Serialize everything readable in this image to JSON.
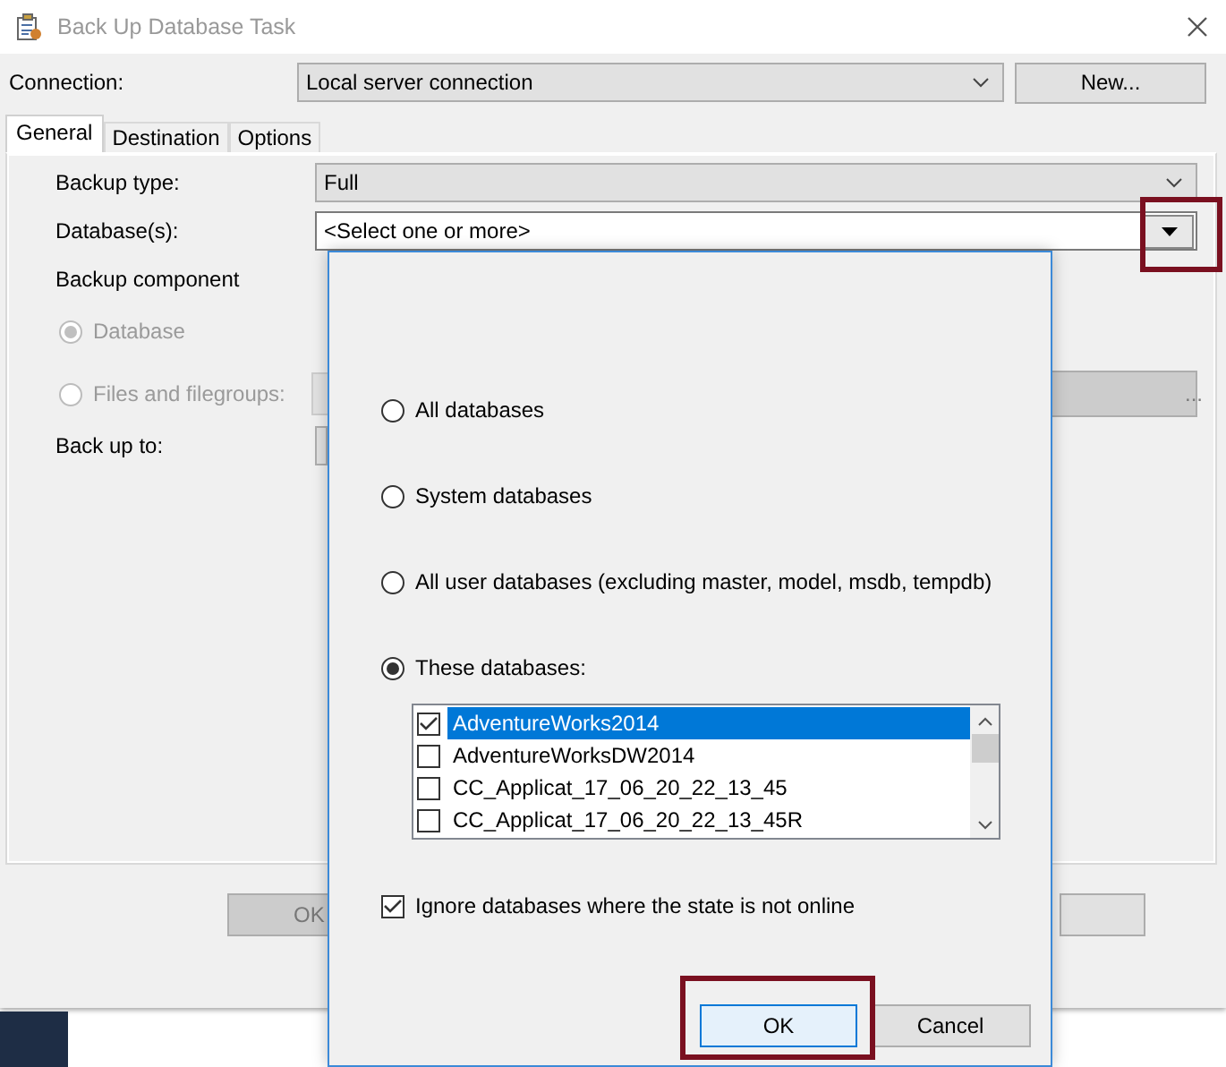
{
  "window": {
    "title": "Back Up Database Task"
  },
  "connection": {
    "label": "Connection:",
    "value": "Local server connection",
    "button": "New..."
  },
  "tabs": [
    {
      "label": "General",
      "selected": true
    },
    {
      "label": "Destination",
      "selected": false
    },
    {
      "label": "Options",
      "selected": false
    }
  ],
  "general": {
    "backup_type": {
      "label": "Backup type:",
      "value": "Full"
    },
    "databases": {
      "label": "Database(s):",
      "placeholder": "<Select one or more>"
    },
    "backup_component": {
      "label": "Backup component",
      "options": [
        {
          "label": "Database",
          "selected": true,
          "disabled": true
        },
        {
          "label": "Files and filegroups:",
          "selected": false,
          "disabled": true
        }
      ],
      "browse_button": "..."
    },
    "back_up_to": {
      "label": "Back up to:"
    }
  },
  "dialog_buttons": [
    "OK"
  ],
  "popup": {
    "options": [
      {
        "label": "All databases",
        "selected": false
      },
      {
        "label": "System databases",
        "selected": false
      },
      {
        "label": "All user databases  (excluding master, model, msdb, tempdb)",
        "selected": false
      },
      {
        "label": "These databases:",
        "selected": true
      }
    ],
    "databases": [
      {
        "label": "AdventureWorks2014",
        "checked": true,
        "selected": true
      },
      {
        "label": "AdventureWorksDW2014",
        "checked": false,
        "selected": false
      },
      {
        "label": "CC_Applicat_17_06_20_22_13_45",
        "checked": false,
        "selected": false
      },
      {
        "label": "CC_Applicat_17_06_20_22_13_45R",
        "checked": false,
        "selected": false
      }
    ],
    "ignore_offline": {
      "label": "Ignore databases where the state is not online",
      "checked": true
    },
    "buttons": [
      {
        "label": "OK",
        "default": true
      },
      {
        "label": "Cancel",
        "default": false
      }
    ]
  }
}
